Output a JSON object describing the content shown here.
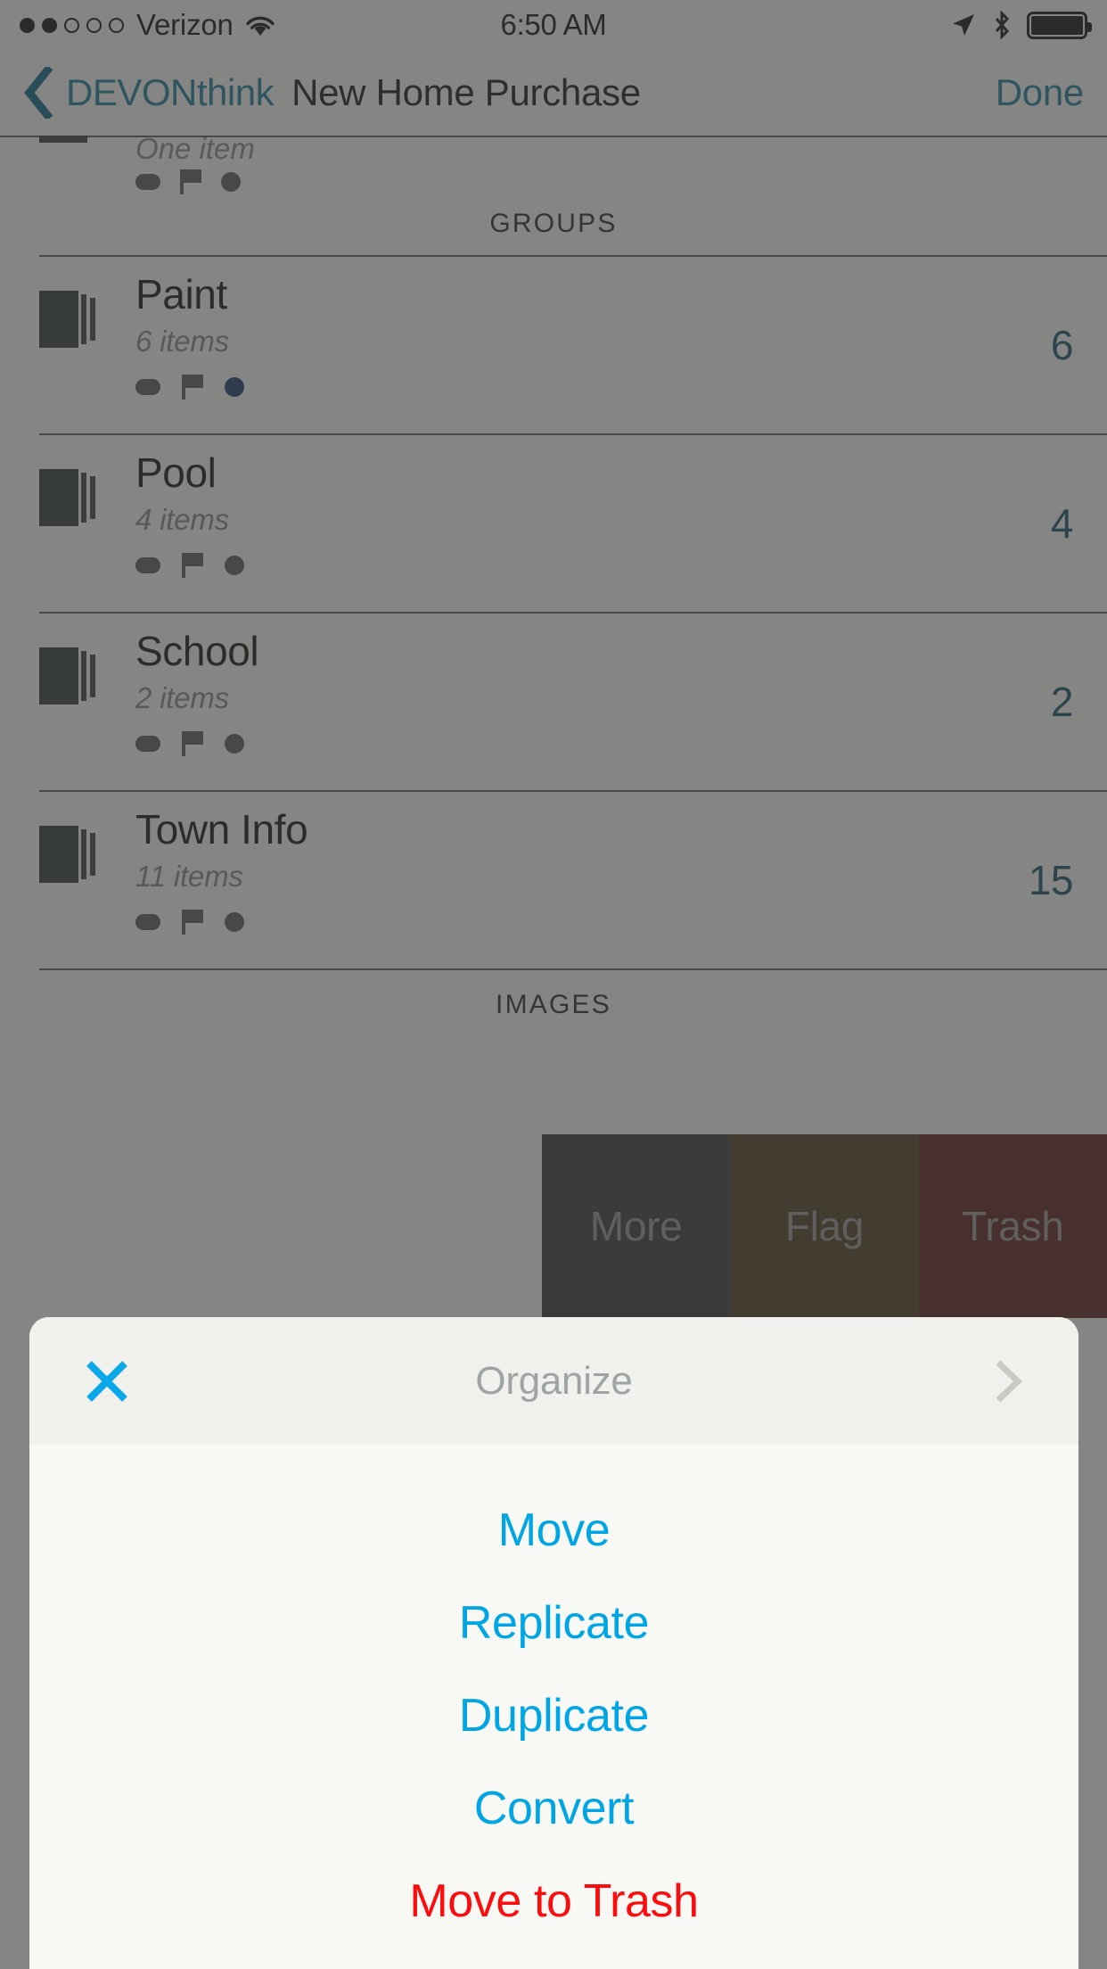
{
  "status_bar": {
    "carrier": "Verizon",
    "signal_bars_filled": 2,
    "signal_bars_total": 5,
    "wifi_icon": "wifi-icon",
    "time": "6:50 AM",
    "location_icon": "location-arrow-icon",
    "bluetooth_icon": "bluetooth-icon",
    "battery_icon": "battery-full-icon"
  },
  "nav_bar": {
    "back_icon": "chevron-left-icon",
    "back_label": "DEVONthink",
    "title": "New Home Purchase",
    "done_label": "Done"
  },
  "list": {
    "partial_row_subtitle": "One item",
    "sections": [
      {
        "header": "GROUPS",
        "rows": [
          {
            "icon": "document-stack-icon",
            "title": "Paint",
            "subtitle": "6 items",
            "count": "6",
            "dot_color": "#1b3f6e"
          },
          {
            "icon": "document-stack-icon",
            "title": "Pool",
            "subtitle": "4 items",
            "count": "4",
            "dot_color": "#5e5e5c"
          },
          {
            "icon": "document-stack-icon",
            "title": "School",
            "subtitle": "2 items",
            "count": "2",
            "dot_color": "#5e5e5c"
          },
          {
            "icon": "document-stack-icon",
            "title": "Town Info",
            "subtitle": "11 items",
            "count": "15",
            "dot_color": "#5e5e5c"
          }
        ]
      },
      {
        "header": "IMAGES",
        "rows": []
      }
    ]
  },
  "swipe_actions": [
    {
      "label": "More",
      "color": "#3b3c3f"
    },
    {
      "label": "Flag",
      "color": "#4e3d23"
    },
    {
      "label": "Trash",
      "color": "#5c1f1f"
    }
  ],
  "action_sheet": {
    "close_icon": "close-x-icon",
    "title": "Organize",
    "next_icon": "chevron-right-icon",
    "items": [
      {
        "label": "Move",
        "destructive": false
      },
      {
        "label": "Replicate",
        "destructive": false
      },
      {
        "label": "Duplicate",
        "destructive": false
      },
      {
        "label": "Convert",
        "destructive": false
      },
      {
        "label": "Move to Trash",
        "destructive": true
      }
    ]
  },
  "colors": {
    "accent_blue": "#00a6e4",
    "destructive_red": "#fc0d0d",
    "nav_tint": "#1b7fa0",
    "count_tint": "#14566b"
  }
}
